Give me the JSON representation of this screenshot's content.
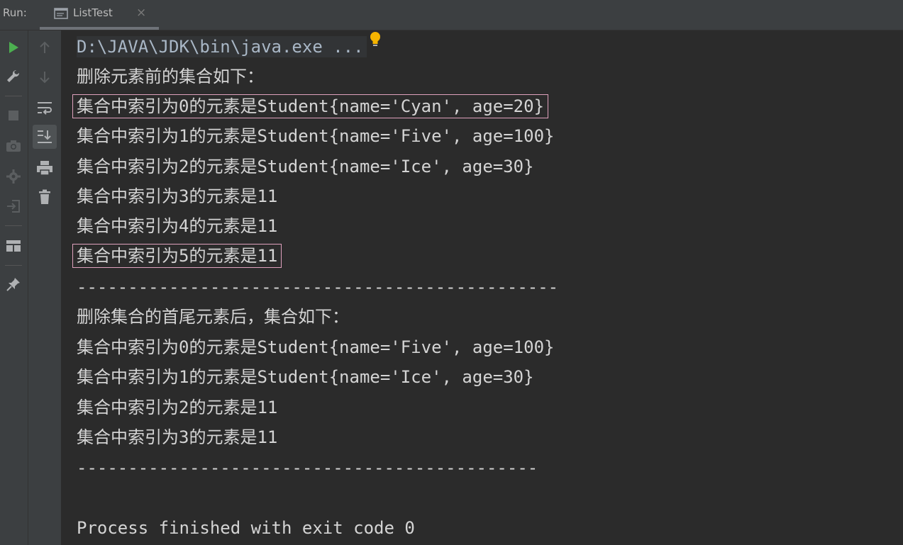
{
  "run_panel": {
    "run_label": "Run:",
    "tab_title": "ListTest",
    "tab_close": "×"
  },
  "toolbar": {
    "left": [
      {
        "name": "run-icon",
        "color": "#4caf50"
      },
      {
        "name": "wrench-icon"
      },
      {
        "name": "stop-icon"
      },
      {
        "name": "camera-icon"
      },
      {
        "name": "gear-bug-icon"
      },
      {
        "name": "login-icon"
      },
      {
        "name": "layout-icon"
      },
      {
        "name": "pin-icon"
      }
    ],
    "right": [
      {
        "name": "arrow-up-icon"
      },
      {
        "name": "arrow-down-icon"
      },
      {
        "name": "soft-wrap-icon"
      },
      {
        "name": "scroll-to-end-icon"
      },
      {
        "name": "print-icon"
      },
      {
        "name": "trash-icon"
      }
    ]
  },
  "console": {
    "command": "D:\\JAVA\\JDK\\bin\\java.exe ...",
    "lines": [
      "删除元素前的集合如下：",
      "集合中索引为0的元素是Student{name='Cyan', age=20}",
      "集合中索引为1的元素是Student{name='Five', age=100}",
      "集合中索引为2的元素是Student{name='Ice', age=30}",
      "集合中索引为3的元素是11",
      "集合中索引为4的元素是11",
      "集合中索引为5的元素是11",
      "-----------------------------------------------",
      "删除集合的首尾元素后，集合如下：",
      "集合中索引为0的元素是Student{name='Five', age=100}",
      "集合中索引为1的元素是Student{name='Ice', age=30}",
      "集合中索引为2的元素是11",
      "集合中索引为3的元素是11",
      "---------------------------------------------",
      "",
      "Process finished with exit code 0"
    ],
    "highlighted_lines": [
      1,
      6
    ]
  },
  "colors": {
    "background": "#2b2b2b",
    "toolbar": "#3c3f41",
    "text": "#d4d4d4",
    "highlight_box": "#e0a1bd",
    "bulb": "#f5b400"
  }
}
